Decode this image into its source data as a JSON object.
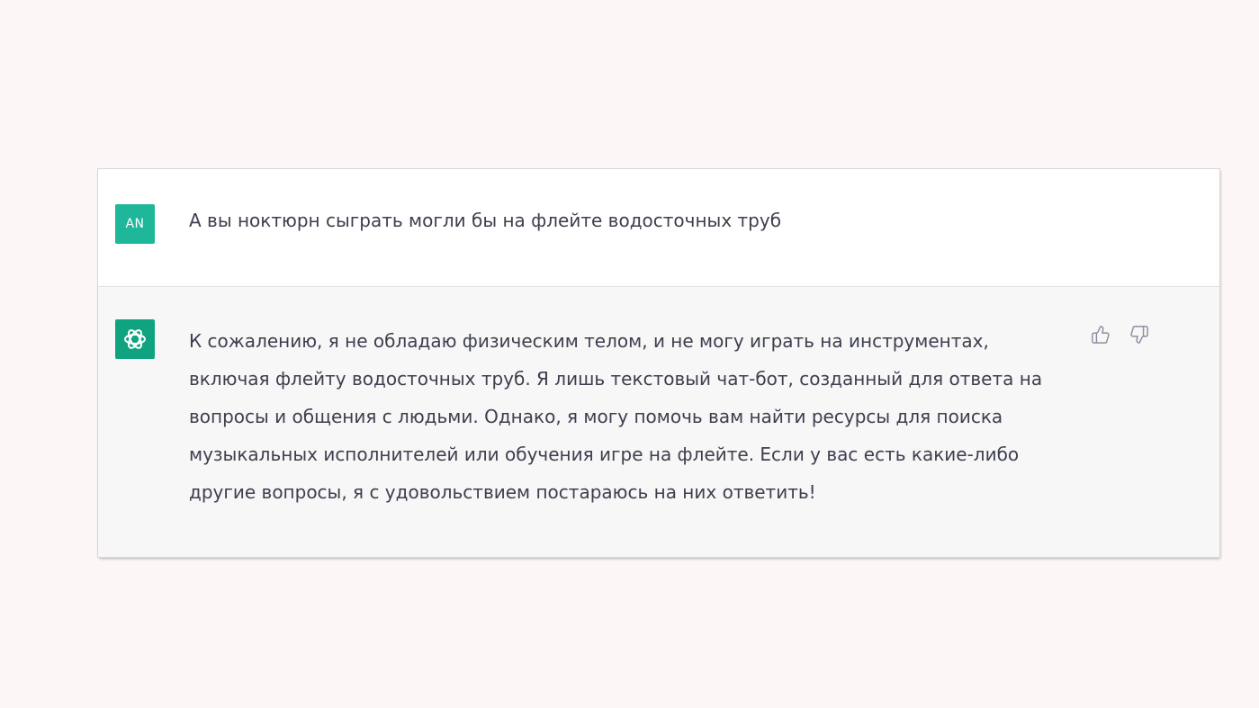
{
  "conversation": {
    "user": {
      "avatar_initials": "AN",
      "message": "А вы ноктюрн сыграть могли бы на флейте водосточных труб"
    },
    "assistant": {
      "avatar_icon": "openai-logo-icon",
      "message_lines": [
        "К сожалению, я не обладаю физическим телом, и не могу играть на инструментах,",
        "включая флейту водосточных труб. Я лишь текстовый чат-бот, созданный для ответа на",
        "вопросы и общения с людьми. Однако, я могу помочь вам найти ресурсы для поиска",
        "музыкальных исполнителей или обучения игре на флейте. Если у вас есть какие-либо",
        "другие вопросы, я с удовольствием постараюсь на них ответить!"
      ],
      "feedback_icons": [
        "thumbs-up-icon",
        "thumbs-down-icon"
      ]
    }
  },
  "colors": {
    "page_background": "#fcf6f6",
    "user_avatar": "#1fb79a",
    "assistant_avatar": "#10a37f",
    "assistant_row_background": "#f7f7f8",
    "text": "#3d3f4d",
    "icon": "#8e8ea0"
  }
}
